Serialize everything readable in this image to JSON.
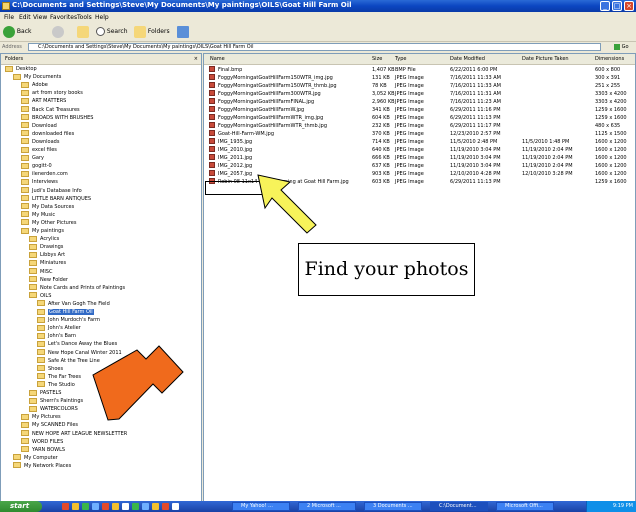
{
  "window": {
    "title": "C:\\Documents and Settings\\Steve\\My Documents\\My paintings\\OILS\\Goat Hill Farm Oil"
  },
  "menu": [
    "File",
    "Edit",
    "View",
    "Favorites",
    "Tools",
    "Help"
  ],
  "toolbar": {
    "back_label": "Back",
    "search_label": "Search",
    "folders_label": "Folders"
  },
  "address": {
    "label": "Address",
    "value": "C:\\Documents and Settings\\Steve\\My Documents\\My paintings\\OILS\\Goat Hill Farm Oil",
    "go_label": "Go"
  },
  "folders_pane": {
    "header": "Folders",
    "close_glyph": "×",
    "items": [
      {
        "label": "Desktop",
        "selected": false
      },
      {
        "label": "My Documents",
        "selected": false
      },
      {
        "label": "Adobe",
        "selected": false
      },
      {
        "label": "art from story books",
        "selected": false
      },
      {
        "label": "ART MATTERS",
        "selected": false
      },
      {
        "label": "Back Cat Treasures",
        "selected": false
      },
      {
        "label": "BROADS WITH BRUSHES",
        "selected": false
      },
      {
        "label": "Download",
        "selected": false
      },
      {
        "label": "downloaded files",
        "selected": false
      },
      {
        "label": "Downloads",
        "selected": false
      },
      {
        "label": "excel files",
        "selected": false
      },
      {
        "label": "Gary",
        "selected": false
      },
      {
        "label": "gogitt-0",
        "selected": false
      },
      {
        "label": "ilenerden.com",
        "selected": false
      },
      {
        "label": "Interviews",
        "selected": false
      },
      {
        "label": "Judi's Database Info",
        "selected": false
      },
      {
        "label": "LITTLE BARN ANTIQUES",
        "selected": false
      },
      {
        "label": "My Data Sources",
        "selected": false
      },
      {
        "label": "My Music",
        "selected": false
      },
      {
        "label": "My Other Pictures",
        "selected": false
      },
      {
        "label": "My paintings",
        "selected": false
      },
      {
        "label": "Acrylics",
        "selected": false
      },
      {
        "label": "Drawings",
        "selected": false
      },
      {
        "label": "Libbys Art",
        "selected": false
      },
      {
        "label": "Miniatures",
        "selected": false
      },
      {
        "label": "MISC",
        "selected": false
      },
      {
        "label": "New Folder",
        "selected": false
      },
      {
        "label": "Note Cards and Prints of Paintings",
        "selected": false
      },
      {
        "label": "OILS",
        "selected": false
      },
      {
        "label": "After Van Gogh The Field",
        "selected": false
      },
      {
        "label": "Goat Hill Farm Oil",
        "selected": true
      },
      {
        "label": "John Murdoch's Farm",
        "selected": false
      },
      {
        "label": "John's Atelier",
        "selected": false
      },
      {
        "label": "John's Barn",
        "selected": false
      },
      {
        "label": "Let's Dance Away the Blues",
        "selected": false
      },
      {
        "label": "New Hope Canal Winter 2011",
        "selected": false
      },
      {
        "label": "Safe At the Tree Line",
        "selected": false
      },
      {
        "label": "Shoes",
        "selected": false
      },
      {
        "label": "The Far Trees",
        "selected": false
      },
      {
        "label": "The Studio",
        "selected": false
      },
      {
        "label": "PASTELS",
        "selected": false
      },
      {
        "label": "Sherri's Paintings",
        "selected": false
      },
      {
        "label": "WATERCOLORS",
        "selected": false
      },
      {
        "label": "My Pictures",
        "selected": false
      },
      {
        "label": "My SCANNED Files",
        "selected": false
      },
      {
        "label": "NEW HOPE ART LEAGUE NEWSLETTER",
        "selected": false
      },
      {
        "label": "WORD FILES",
        "selected": false
      },
      {
        "label": "YARN BOWLS",
        "selected": false
      },
      {
        "label": "My Computer",
        "selected": false
      },
      {
        "label": "My Network Places",
        "selected": false
      }
    ]
  },
  "file_list": {
    "columns": [
      "Name",
      "Size",
      "Type",
      "Date Modified",
      "Date Picture Taken",
      "Dimensions"
    ],
    "rows": [
      {
        "name": "Final.bmp",
        "size": "1,407 KB",
        "type": "BMP File",
        "modified": "6/22/2011 6:00 PM",
        "taken": "",
        "dims": "600 x 800"
      },
      {
        "name": "FoggyMorningatGoatHillFarm150WTR_img.jpg",
        "size": "131 KB",
        "type": "JPEG Image",
        "modified": "7/16/2011 11:33 AM",
        "taken": "",
        "dims": "300 x 391"
      },
      {
        "name": "FoggyMorningatGoatHillFarm150WTR_thmb.jpg",
        "size": "78 KB",
        "type": "JPEG Image",
        "modified": "7/16/2011 11:33 AM",
        "taken": "",
        "dims": "251 x 255"
      },
      {
        "name": "FoggyMorningatGoatHillFarm300WTR.jpg",
        "size": "3,052 KB",
        "type": "JPEG Image",
        "modified": "7/16/2011 11:31 AM",
        "taken": "",
        "dims": "3303 x 4200"
      },
      {
        "name": "FoggyMorningatGoatHillFarmFINAL.jpg",
        "size": "2,960 KB",
        "type": "JPEG Image",
        "modified": "7/16/2011 11:23 AM",
        "taken": "",
        "dims": "3303 x 4200"
      },
      {
        "name": "FoggyMorningatGoatHillFarmW.jpg",
        "size": "341 KB",
        "type": "JPEG Image",
        "modified": "6/29/2011 11:16 PM",
        "taken": "",
        "dims": "1259 x 1600"
      },
      {
        "name": "FoggyMorningatGoatHillFarmWTR_img.jpg",
        "size": "604 KB",
        "type": "JPEG Image",
        "modified": "6/29/2011 11:13 PM",
        "taken": "",
        "dims": "1259 x 1600"
      },
      {
        "name": "FoggyMorningatGoatHillFarmWTR_thmb.jpg",
        "size": "232 KB",
        "type": "JPEG Image",
        "modified": "6/29/2011 11:17 PM",
        "taken": "",
        "dims": "480 x 635"
      },
      {
        "name": "Goat-Hill-Farm-WM.jpg",
        "size": "370 KB",
        "type": "JPEG Image",
        "modified": "12/23/2010 2:57 PM",
        "taken": "",
        "dims": "1125 x 1500"
      },
      {
        "name": "IMG_1935.jpg",
        "size": "714 KB",
        "type": "JPEG Image",
        "modified": "11/5/2010 2:48 PM",
        "taken": "11/5/2010 1:48 PM",
        "dims": "1600 x 1200"
      },
      {
        "name": "IMG_2010.jpg",
        "size": "640 KB",
        "type": "JPEG Image",
        "modified": "11/19/2010 3:04 PM",
        "taken": "11/19/2010 2:04 PM",
        "dims": "1600 x 1200"
      },
      {
        "name": "IMG_2011.jpg",
        "size": "666 KB",
        "type": "JPEG Image",
        "modified": "11/19/2010 3:04 PM",
        "taken": "11/19/2010 2:04 PM",
        "dims": "1600 x 1200"
      },
      {
        "name": "IMG_2012.jpg",
        "size": "637 KB",
        "type": "JPEG Image",
        "modified": "11/19/2010 3:04 PM",
        "taken": "11/19/2010 2:04 PM",
        "dims": "1600 x 1200"
      },
      {
        "name": "IMG_2057.jpg",
        "size": "903 KB",
        "type": "JPEG Image",
        "modified": "12/10/2010 4:28 PM",
        "taken": "12/10/2010 3:28 PM",
        "dims": "1600 x 1200"
      },
      {
        "name": "Robin 08 11x14 Foggy Morning at Goat Hill Farm.jpg",
        "size": "603 KB",
        "type": "JPEG Image",
        "modified": "6/29/2011 11:13 PM",
        "taken": "",
        "dims": "1259 x 1600"
      }
    ]
  },
  "callout_text": "Find your photos",
  "taskbar": {
    "start_label": "start",
    "tasks": [
      "My Yahoo! ...",
      "2 Microsoft ...",
      "3 Documents ...",
      "C:\\Document...",
      "Microsoft Offi..."
    ],
    "clock": "9:19 PM"
  },
  "colors": {
    "titlebar": "#0b46c1",
    "selection": "#316ac5",
    "orange_arrow": "#f06a1c",
    "yellow_arrow": "#f7f35a",
    "start": "#3a9a3a"
  }
}
